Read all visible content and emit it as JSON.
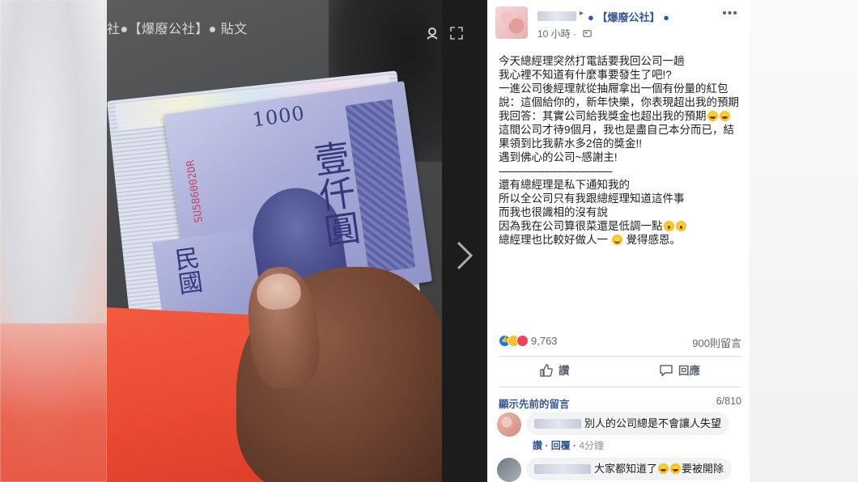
{
  "watermark": "社●【爆廢公社】● 貼文",
  "viewer": {
    "tag_icon": "tag-icon",
    "expand_icon": "expand-icon",
    "next_icon": "chevron-right-icon",
    "photo_denomination": "1000",
    "photo_serial": "SU586002DR",
    "photo_chars": "壹仟圓",
    "photo_chars2": "民國"
  },
  "post": {
    "group_name": "【爆廢公社】",
    "time": "10 小時",
    "more_icon": "more-options-icon",
    "body": {
      "line1": "今天總經理突然打電話要我回公司一趟",
      "line2": "我心裡不知道有什麼事要發生了吧!?",
      "line3": "一進公司後經理就從抽屜拿出一個有份量的紅包說：這個給你的，新年快樂，你表現超出我的預期",
      "line4a": "我回答：其實公司給我獎金也超出我的預期",
      "line5": "這間公司才待9個月，我也是盡自己本分而已，結果領到比我薪水多2倍的獎金!!",
      "line6": "遇到佛心的公司~感謝主!",
      "line7": "----------------------------------------",
      "line8": "還有總經理是私下通知我的",
      "line9": "所以全公司只有我跟總經理知道這件事",
      "line10": "而我也很識相的沒有說",
      "line11": "因為我在公司算很菜還是低調一點",
      "line12a": "總經理也比較好做人一",
      "line12b": "覺得感恩。"
    },
    "reaction_count": "9,763",
    "comment_count": "900則留言",
    "actions": {
      "like_label": "讚",
      "comment_label": "回應"
    }
  },
  "comments_section": {
    "prev_label": "顯示先前的留言",
    "pagination": "6/810",
    "comments": [
      {
        "text": "別人的公司總是不會讓人失望",
        "like": "讚",
        "reply": "回覆",
        "time": "4分鐘"
      },
      {
        "text_a": "大家都知道了",
        "text_b": "要被開除"
      }
    ]
  },
  "colors": {
    "link": "#365899",
    "meta": "#616770",
    "like_blue": "#1877f2",
    "envelope_red": "#ea4a33"
  }
}
